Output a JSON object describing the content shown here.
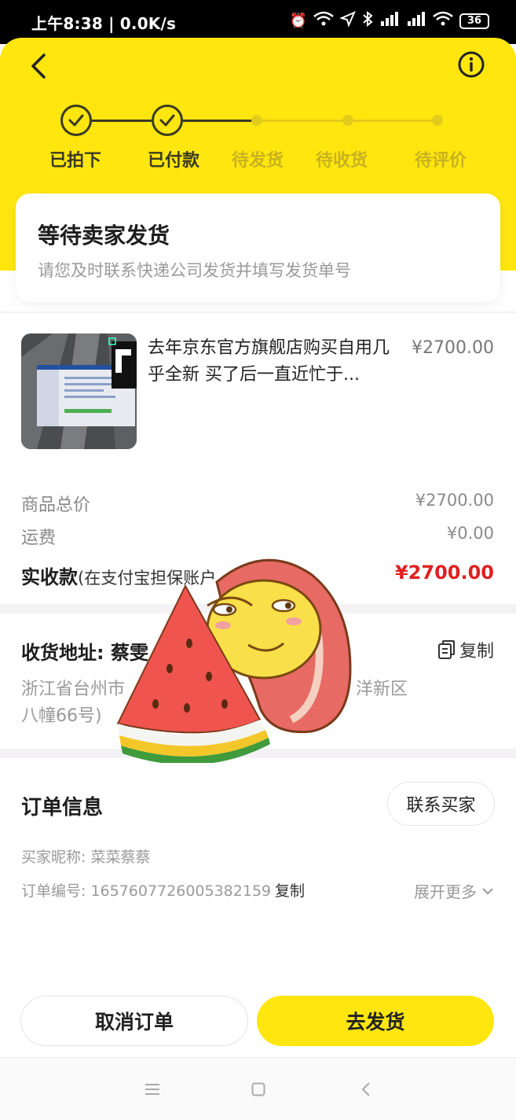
{
  "status_bar": {
    "time": "上午8:38 | 0.0K/s",
    "battery": "36"
  },
  "header": {
    "steps": [
      {
        "label": "已拍下",
        "done": true
      },
      {
        "label": "已付款",
        "done": true
      },
      {
        "label": "待发货",
        "done": false
      },
      {
        "label": "待收货",
        "done": false
      },
      {
        "label": "待评价",
        "done": false
      }
    ]
  },
  "status_card": {
    "title": "等待卖家发货",
    "subtitle": "请您及时联系快递公司发货并填写发货单号"
  },
  "product": {
    "title": "去年京东官方旗舰店购买自用几乎全新 买了后一直近忙于...",
    "price": "¥2700.00"
  },
  "summary": {
    "goods_total_label": "商品总价",
    "goods_total_value": "¥2700.00",
    "shipping_label": "运费",
    "shipping_value": "¥0.00",
    "received_label": "实收款",
    "received_note": "(在支付宝担保账户",
    "received_value": "¥2700.00"
  },
  "address": {
    "title": "收货地址: 蔡雯",
    "copy_label": "复制",
    "line1": "浙江省台州市",
    "line1_tail": "洋新区",
    "line2": "八幢66号)"
  },
  "order_info": {
    "title": "订单信息",
    "contact_button": "联系买家",
    "buyer_nick_label": "买家昵称: 菜菜蔡蔡",
    "order_no_label": "订单编号: 1657607726005382159",
    "copy_label": "复制",
    "expand_label": "展开更多"
  },
  "actions": {
    "cancel": "取消订单",
    "ship": "去发货"
  },
  "colors": {
    "brand_yellow": "#ffe60f",
    "price_red": "#e02020"
  }
}
